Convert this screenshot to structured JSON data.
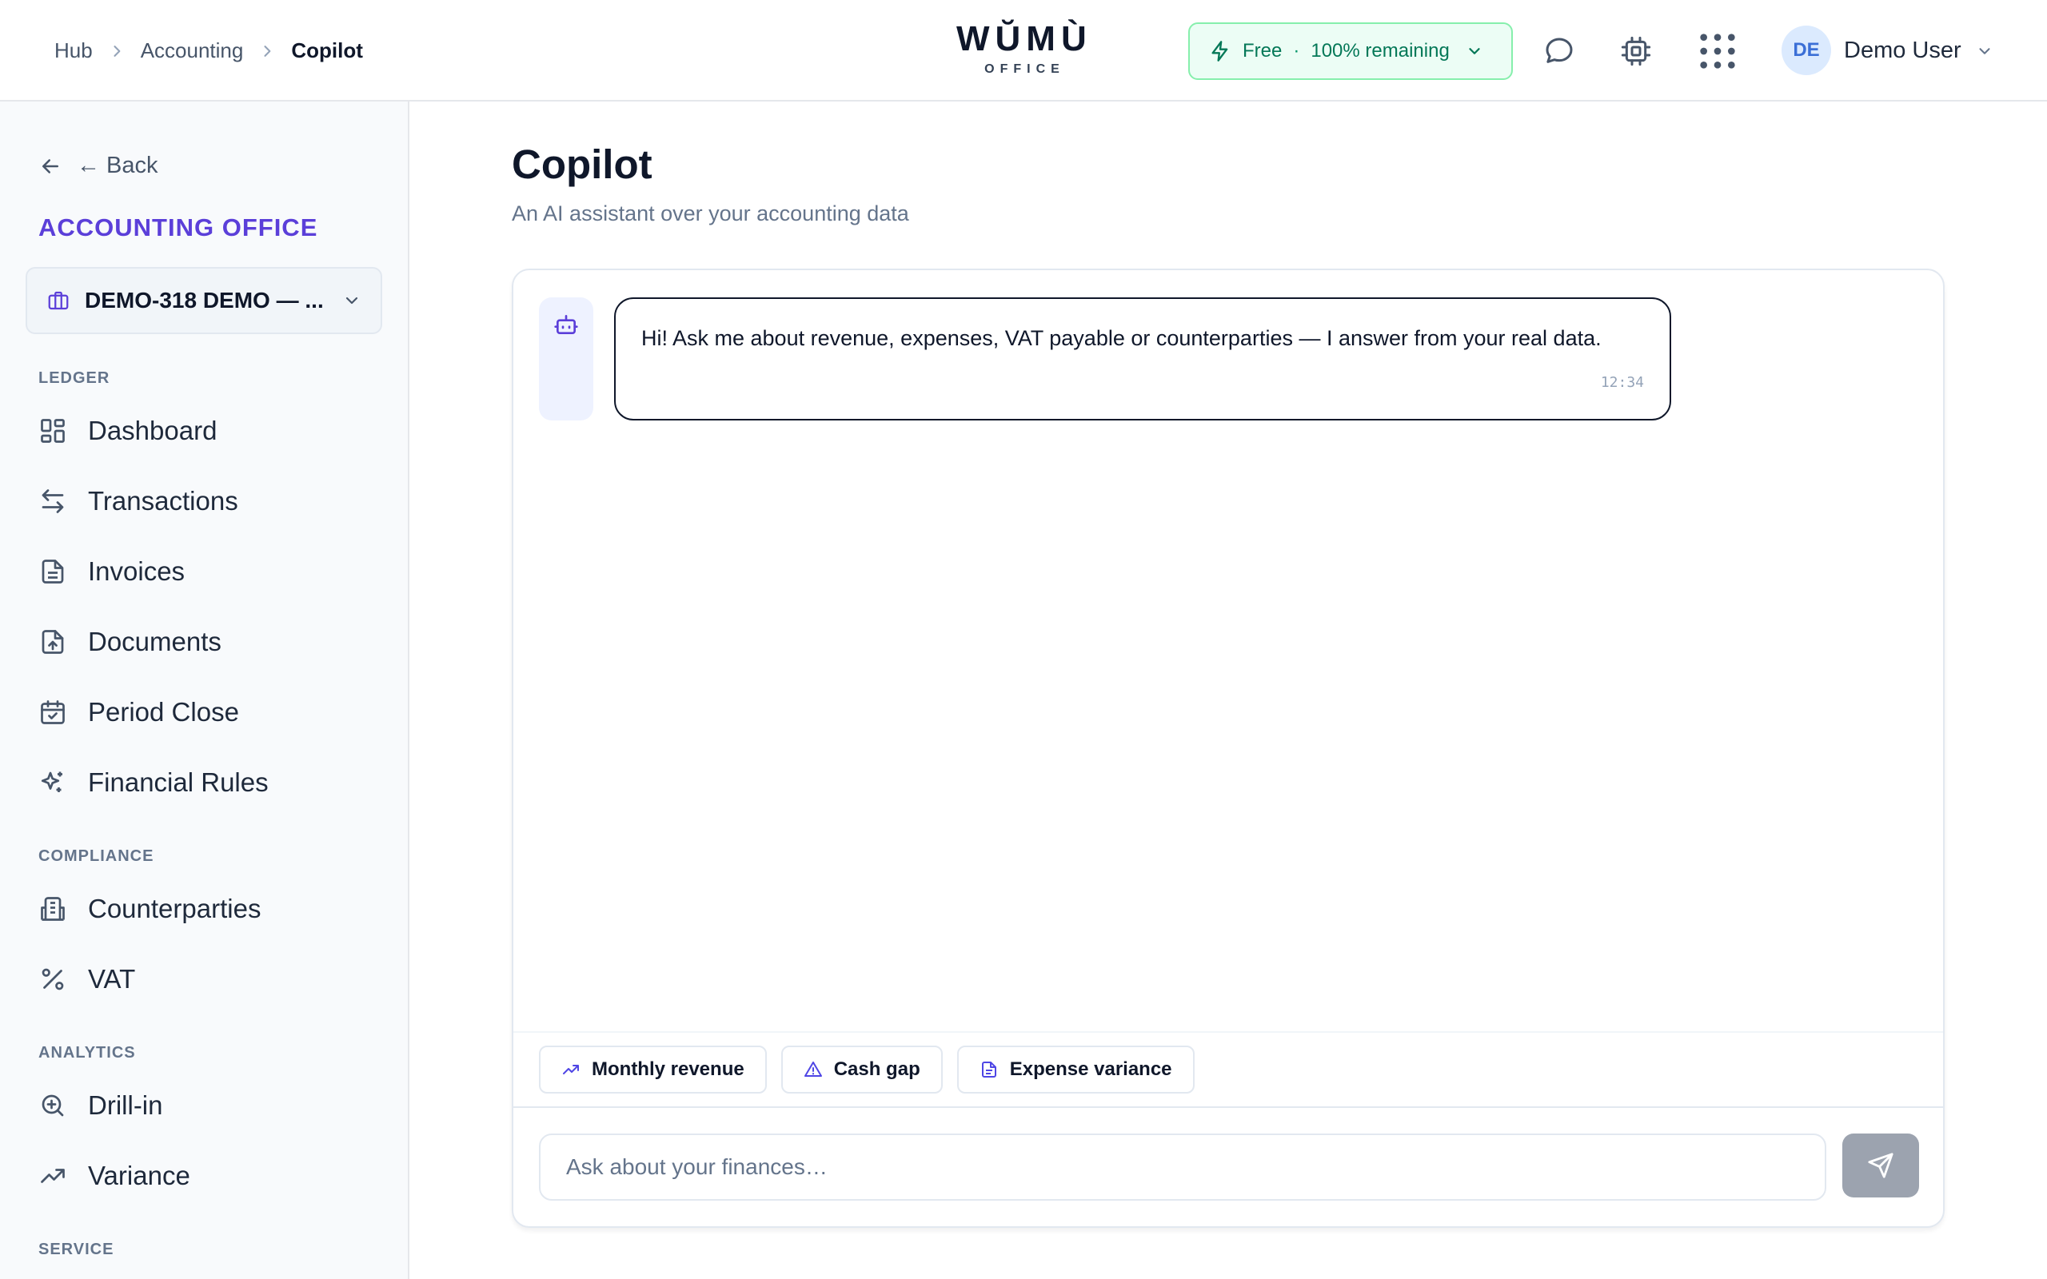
{
  "breadcrumb": [
    "Hub",
    "Accounting",
    "Copilot"
  ],
  "logo": {
    "main": "WŬMÙ",
    "sub": "OFFICE"
  },
  "plan": {
    "name": "Free",
    "separator": "·",
    "remaining": "100% remaining"
  },
  "user": {
    "initials": "DE",
    "name": "Demo User"
  },
  "sidebar": {
    "back_label": "← Back",
    "office_title": "ACCOUNTING OFFICE",
    "org_selector": "DEMO-318 DEMO — ...",
    "sections": {
      "ledger": "LEDGER",
      "compliance": "COMPLIANCE",
      "analytics": "ANALYTICS",
      "service": "SERVICE"
    },
    "ledger_items": [
      "Dashboard",
      "Transactions",
      "Invoices",
      "Documents",
      "Period Close",
      "Financial Rules"
    ],
    "compliance_items": [
      "Counterparties",
      "VAT"
    ],
    "analytics_items": [
      "Drill-in",
      "Variance"
    ]
  },
  "page": {
    "title": "Copilot",
    "subtitle": "An AI assistant over your accounting data"
  },
  "chat": {
    "messages": [
      {
        "text": "Hi! Ask me about revenue, expenses, VAT payable or counterparties — I answer from your real data.",
        "time": "12:34"
      }
    ],
    "suggestions": [
      "Monthly revenue",
      "Cash gap",
      "Expense variance"
    ],
    "input_placeholder": "Ask about your finances…"
  },
  "colors": {
    "accent": "#5b3fd9",
    "plan_bg": "#ecfdf5",
    "plan_text": "#047857",
    "send_disabled": "#9ca3af"
  }
}
